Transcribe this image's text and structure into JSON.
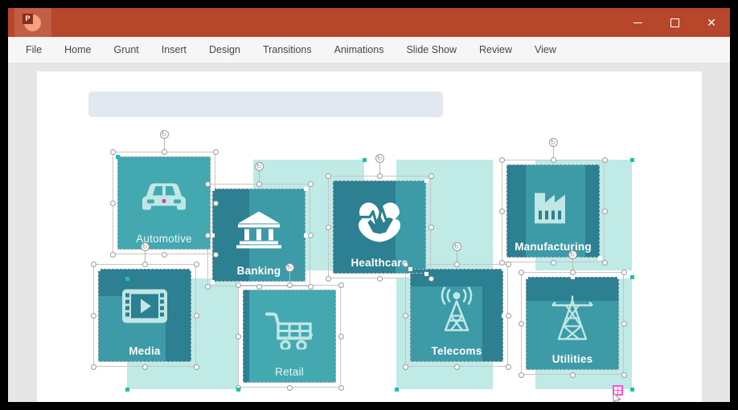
{
  "window": {
    "app_name": "PowerPoint",
    "logo_letter": "P",
    "controls": {
      "minimize": "—",
      "maximize": "▢",
      "close": "✕"
    },
    "colors": {
      "titlebar": "#b7472a",
      "logo_tile": "#c15e43",
      "menubar": "#f7f6f5",
      "workspace": "#e6e6e6",
      "slide": "#ffffff"
    }
  },
  "menu": {
    "items": [
      {
        "label": "File"
      },
      {
        "label": "Home"
      },
      {
        "label": "Grunt"
      },
      {
        "label": "Insert"
      },
      {
        "label": "Design"
      },
      {
        "label": "Transitions"
      },
      {
        "label": "Animations"
      },
      {
        "label": "Slide Show"
      },
      {
        "label": "Review"
      },
      {
        "label": "View"
      }
    ]
  },
  "slide": {
    "title_placeholder_text": "",
    "palette": {
      "teal_mid": "#44a8b0",
      "teal_dark": "#2d7f92",
      "mint_light": "#bfeae6",
      "title_fill": "#e2e8ef",
      "icon_light": "#bfe7e3",
      "icon_white": "#ffffff",
      "label_light": "#eaf7f7",
      "accent_pink": "#ff4fd8",
      "handle_teal": "#1fc0b4"
    },
    "cards": [
      {
        "label": "Automotive",
        "icon": "car-icon",
        "tone": "mid"
      },
      {
        "label": "Banking",
        "icon": "bank-icon",
        "tone": "dark"
      },
      {
        "label": "Healthcare",
        "icon": "heart-hands-icon",
        "tone": "dark"
      },
      {
        "label": "Manufacturing",
        "icon": "factory-icon",
        "tone": "dark"
      },
      {
        "label": "Media",
        "icon": "film-play-icon",
        "tone": "dark"
      },
      {
        "label": "Retail",
        "icon": "shopping-cart-icon",
        "tone": "mid"
      },
      {
        "label": "Telecoms",
        "icon": "antenna-icon",
        "tone": "dark"
      },
      {
        "label": "Utilities",
        "icon": "pylon-icon",
        "tone": "dark"
      }
    ]
  }
}
